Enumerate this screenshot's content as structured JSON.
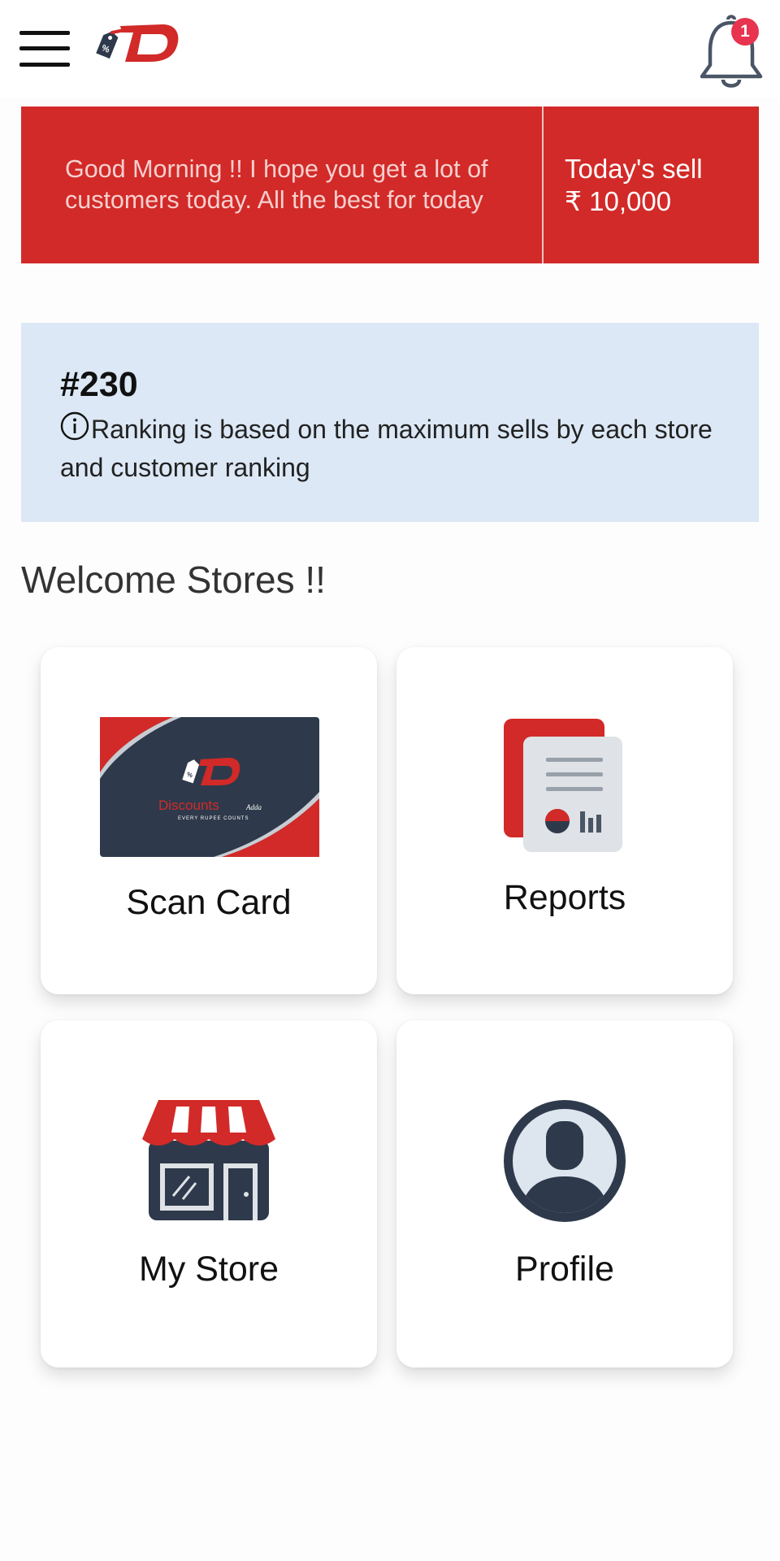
{
  "header": {
    "menu_icon": "hamburger-menu-icon",
    "logo_icon": "discounts-adda-logo",
    "notification_icon": "bell-icon",
    "notification_count": "1"
  },
  "banner": {
    "greeting": "Good Morning  !! I hope you get a lot of customers today. All the best for today",
    "sell_label": "Today's sell",
    "sell_value": "₹ 10,000"
  },
  "ranking": {
    "rank": "#230",
    "info_icon": "info-icon",
    "info_text": "Ranking is based on the maximum sells by each store and customer ranking"
  },
  "welcome": "Welcome  Stores !!",
  "tiles": [
    {
      "label": "Scan Card",
      "icon": "discount-card-icon"
    },
    {
      "label": "Reports",
      "icon": "report-document-icon"
    },
    {
      "label": "My Store",
      "icon": "storefront-icon"
    },
    {
      "label": "Profile",
      "icon": "user-avatar-icon"
    }
  ],
  "colors": {
    "brand_red": "#d22a28",
    "rank_card_bg": "#dce8f5",
    "card_navy": "#2e3a4b",
    "badge": "#e8344f"
  }
}
